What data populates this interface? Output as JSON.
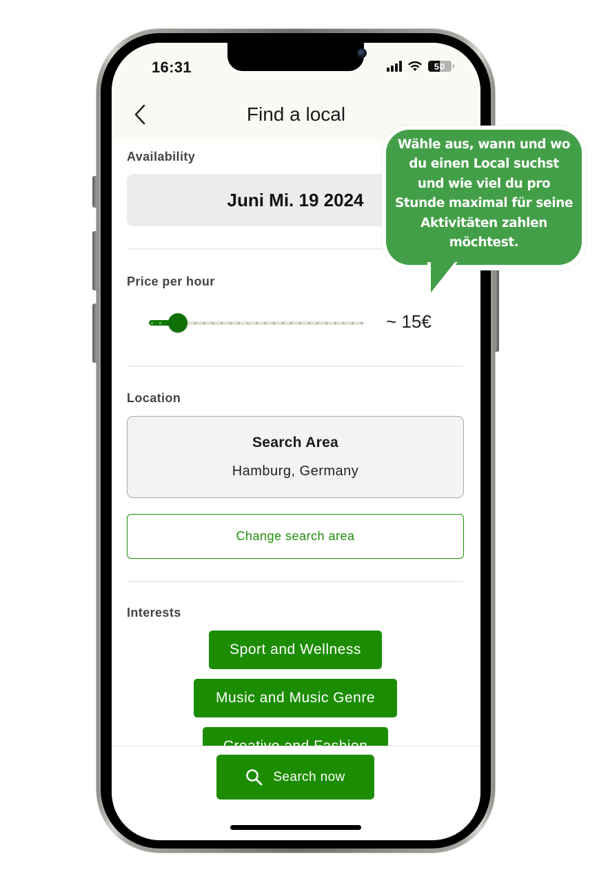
{
  "status_bar": {
    "time": "16:31",
    "battery_level": "50",
    "battery_fraction": 0.5
  },
  "header": {
    "title": "Find a local",
    "back_icon": "chevron-left-icon"
  },
  "availability": {
    "label": "Availability",
    "date": "Juni Mi. 19 2024"
  },
  "price": {
    "label": "Price per hour",
    "value_text": "~ 15€",
    "slider_fraction": 0.125,
    "slider_steps": 25
  },
  "location": {
    "label": "Location",
    "box_title": "Search Area",
    "box_value": "Hamburg, Germany",
    "change_button": "Change search area"
  },
  "interests": {
    "label": "Interests",
    "chips": [
      {
        "label": "Sport and Wellness"
      },
      {
        "label": "Music and Music Genre"
      },
      {
        "label": "Creative and Fashion"
      }
    ]
  },
  "footer": {
    "search_button": "Search now",
    "search_icon": "search-icon"
  },
  "tooltip": {
    "text": "Wähle aus, wann und wo du einen Local suchst und wie viel du pro Stunde maximal für seine Aktivitäten zahlen möchtest.",
    "lines": [
      "Wähle aus, wann und wo",
      "du einen Local suchst",
      "und wie viel du pro",
      "Stunde maximal für seine",
      "Aktivitäten zahlen",
      "möchtest."
    ]
  },
  "colors": {
    "primary_green": "#1c8d03",
    "slider_green": "#0e7006",
    "tooltip_green": "#439f47",
    "header_bg": "#fafaf5"
  }
}
